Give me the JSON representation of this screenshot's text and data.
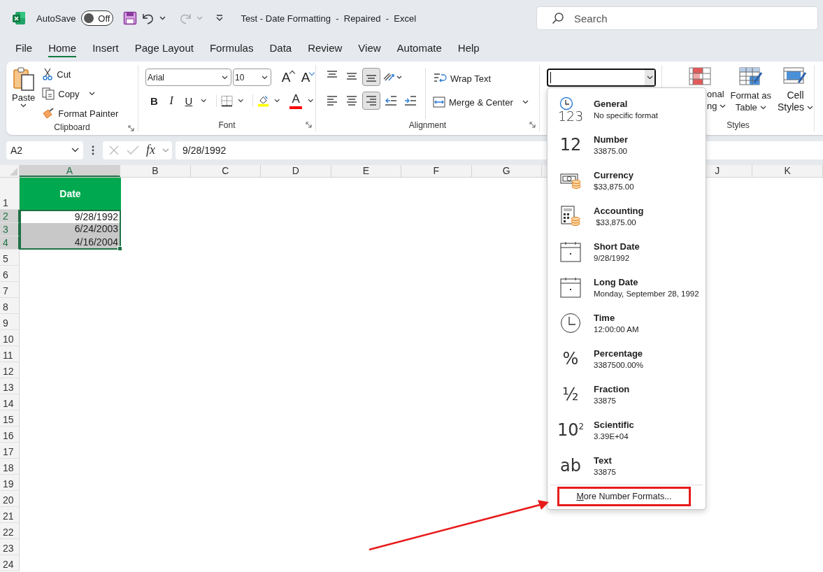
{
  "title_bar": {
    "autosave_label": "AutoSave",
    "autosave": {
      "on": false,
      "label": "Off"
    },
    "redo_disabled": true,
    "title": "Test - Date Formatting  -  Repaired  -  Excel",
    "search": {
      "placeholder": "Search"
    }
  },
  "menu_tabs": [
    {
      "label": "File",
      "selected": false
    },
    {
      "label": "Home",
      "selected": true
    },
    {
      "label": "Insert",
      "selected": false
    },
    {
      "label": "Page Layout",
      "selected": false
    },
    {
      "label": "Formulas",
      "selected": false
    },
    {
      "label": "Data",
      "selected": false
    },
    {
      "label": "Review",
      "selected": false
    },
    {
      "label": "View",
      "selected": false
    },
    {
      "label": "Automate",
      "selected": false
    },
    {
      "label": "Help",
      "selected": false
    }
  ],
  "clipboard": {
    "paste": "Paste",
    "items": [
      {
        "kind": "cut",
        "label": "Cut",
        "caret": false
      },
      {
        "kind": "copy",
        "label": "Copy",
        "caret": true
      },
      {
        "kind": "painter",
        "label": "Format Painter",
        "caret": false
      }
    ],
    "label": "Clipboard"
  },
  "font": {
    "family": "Arial",
    "size": "10",
    "size_tools": [
      {
        "kind": "grow",
        "glyph": "A"
      },
      {
        "kind": "shrink",
        "glyph": "A"
      }
    ],
    "format_tools": [
      {
        "kind": "bold",
        "glyph": "B",
        "caret": false
      },
      {
        "kind": "italic",
        "glyph": "I",
        "caret": false
      },
      {
        "kind": "underline",
        "glyph": "U",
        "caret": true
      },
      {
        "kind": "borders",
        "caret": true
      },
      {
        "kind": "fill",
        "color": "#ffff00",
        "caret": true
      },
      {
        "kind": "font-color",
        "glyph": "A",
        "color": "#ff0000",
        "caret": true
      }
    ],
    "label": "Font"
  },
  "alignment": {
    "top_row": [
      {
        "kind": "top",
        "selected": false
      },
      {
        "kind": "middle",
        "selected": false
      },
      {
        "kind": "bottom",
        "selected": true
      },
      {
        "kind": "orientation",
        "selected": false
      }
    ],
    "bottom_row": [
      {
        "kind": "left",
        "selected": false
      },
      {
        "kind": "center",
        "selected": false
      },
      {
        "kind": "right",
        "selected": true
      },
      {
        "kind": "indent-decrease",
        "selected": false
      },
      {
        "kind": "indent-increase",
        "selected": false
      }
    ],
    "wrap": "Wrap Text",
    "merge": "Merge & Center",
    "label": "Alignment"
  },
  "number_format_field": {
    "focused": true
  },
  "styles": {
    "buttons": [
      {
        "kind": "conditional",
        "lines": [
          "onal",
          "ng"
        ]
      },
      {
        "kind": "table",
        "lines": [
          "Format as",
          "Table"
        ]
      },
      {
        "kind": "cell",
        "lines": [
          "Cell",
          "Styles"
        ]
      }
    ],
    "label": "Styles"
  },
  "formula_bar": {
    "name_box": "A2",
    "fx": "fx",
    "formula": "9/28/1992"
  },
  "sheet": {
    "columns": [
      {
        "label": "A",
        "selected": true
      },
      {
        "label": "B",
        "selected": false
      },
      {
        "label": "C",
        "selected": false
      },
      {
        "label": "D",
        "selected": false
      },
      {
        "label": "E",
        "selected": false
      },
      {
        "label": "F",
        "selected": false
      },
      {
        "label": "G",
        "selected": false
      },
      {
        "label": "J",
        "selected": false
      },
      {
        "label": "K",
        "selected": false
      }
    ],
    "rows": [
      {
        "number": "1",
        "selected": false,
        "cell": {
          "kind": "header",
          "text": "Date",
          "selected": false
        }
      },
      {
        "number": "2",
        "selected": true,
        "cell": {
          "kind": "date",
          "text": "9/28/1992",
          "selected": true,
          "active": true
        }
      },
      {
        "number": "3",
        "selected": true,
        "cell": {
          "kind": "date",
          "text": "6/24/2003",
          "selected": true,
          "active": false
        }
      },
      {
        "number": "4",
        "selected": true,
        "cell": {
          "kind": "date",
          "text": "4/16/2004",
          "selected": true,
          "active": false
        }
      },
      {
        "number": "5",
        "selected": false
      },
      {
        "number": "6",
        "selected": false
      },
      {
        "number": "7",
        "selected": false
      },
      {
        "number": "8",
        "selected": false
      },
      {
        "number": "9",
        "selected": false
      },
      {
        "number": "10",
        "selected": false
      },
      {
        "number": "11",
        "selected": false
      },
      {
        "number": "12",
        "selected": false
      },
      {
        "number": "13",
        "selected": false
      },
      {
        "number": "14",
        "selected": false
      },
      {
        "number": "15",
        "selected": false
      },
      {
        "number": "16",
        "selected": false
      },
      {
        "number": "17",
        "selected": false
      },
      {
        "number": "18",
        "selected": false
      },
      {
        "number": "19",
        "selected": false
      },
      {
        "number": "20",
        "selected": false
      },
      {
        "number": "21",
        "selected": false
      },
      {
        "number": "22",
        "selected": false
      },
      {
        "number": "23",
        "selected": false
      },
      {
        "number": "24",
        "selected": false
      }
    ]
  },
  "number_format_menu": {
    "items": [
      {
        "kind": "general",
        "glyph": "123",
        "name": "General",
        "example": "No specific format"
      },
      {
        "kind": "glyph",
        "glyph": "12",
        "name": "Number",
        "example": "33875.00"
      },
      {
        "kind": "currency",
        "name": "Currency",
        "example": "$33,875.00"
      },
      {
        "kind": "accounting",
        "name": "Accounting",
        "example": " $33,875.00"
      },
      {
        "kind": "calendar",
        "name": "Short Date",
        "example": "9/28/1992"
      },
      {
        "kind": "calendar",
        "name": "Long Date",
        "example": "Monday, September 28, 1992"
      },
      {
        "kind": "clock",
        "name": "Time",
        "example": "12:00:00 AM"
      },
      {
        "kind": "glyph",
        "glyph": "%",
        "name": "Percentage",
        "example": "3387500.00%"
      },
      {
        "kind": "glyph",
        "glyph": "½",
        "name": "Fraction",
        "example": "33875"
      },
      {
        "kind": "glyph",
        "glyph": "10$^{2}$",
        "name": "Scientific",
        "example": "3.39E+04"
      },
      {
        "kind": "glyph",
        "glyph": "ab",
        "name": "Text",
        "example": "33875"
      }
    ],
    "more": {
      "label": "More Number Formats...",
      "highlighted": true
    }
  },
  "callout_arrow": true
}
